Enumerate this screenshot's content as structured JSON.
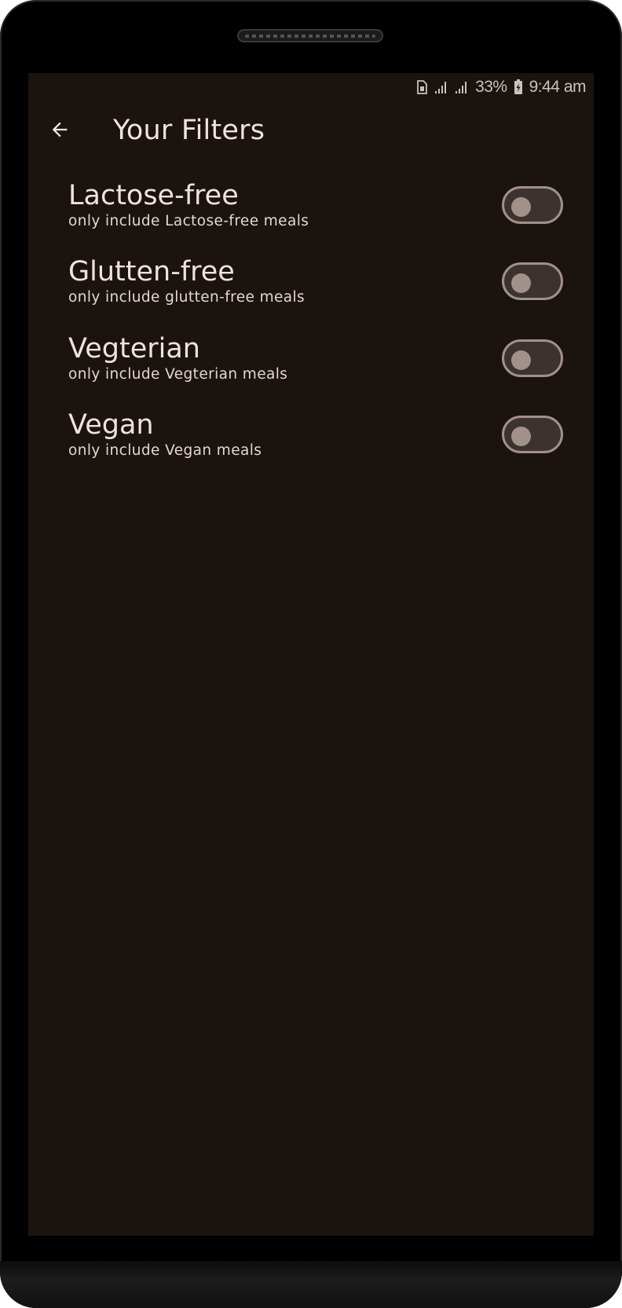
{
  "status_bar": {
    "battery": "33%",
    "time": "9:44 am",
    "icons": [
      "sim-card-icon",
      "signal-icon",
      "signal-icon",
      "battery-charging-icon"
    ]
  },
  "app_bar": {
    "back_icon": "arrow-left-icon",
    "title": "Your Filters"
  },
  "filters": [
    {
      "title": "Lactose-free",
      "subtitle": "only include Lactose-free meals",
      "enabled": false
    },
    {
      "title": "Glutten-free",
      "subtitle": "only include glutten-free meals",
      "enabled": false
    },
    {
      "title": "Vegterian",
      "subtitle": "only include Vegterian meals",
      "enabled": false
    },
    {
      "title": "Vegan",
      "subtitle": "only include Vegan meals",
      "enabled": false
    }
  ],
  "colors": {
    "background": "#1b1310",
    "text": "#f1e2db",
    "switch_track": "#3c3330",
    "switch_thumb": "#a2908a"
  }
}
